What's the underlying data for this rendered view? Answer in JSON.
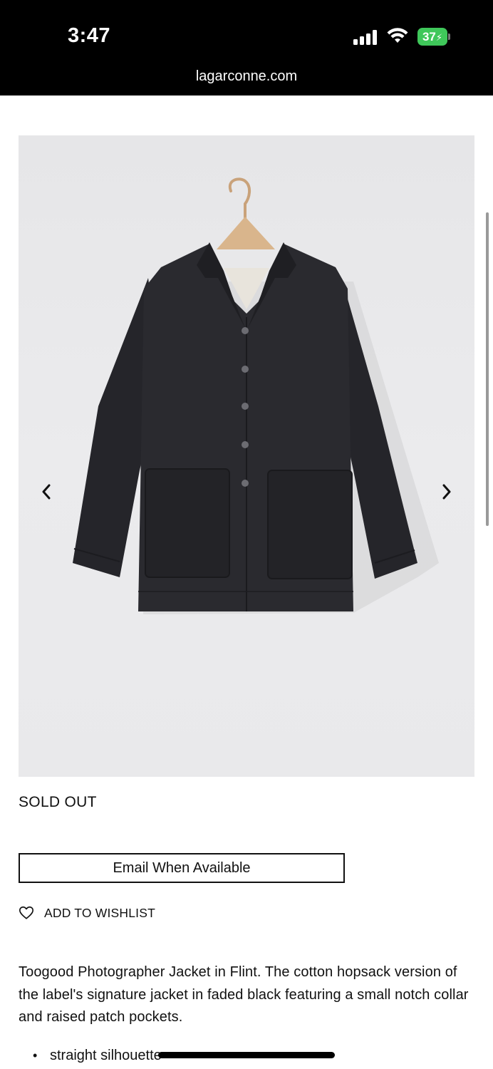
{
  "status_bar": {
    "time": "3:47",
    "battery": "37",
    "battery_color": "#3fc75a"
  },
  "browser": {
    "url": "lagarconne.com"
  },
  "gallery": {
    "prev_icon": "chevron-left-icon",
    "next_icon": "chevron-right-icon"
  },
  "product": {
    "availability": "SOLD OUT",
    "email_button_label": "Email When Available",
    "wishlist_label": "ADD TO WISHLIST",
    "description": "Toogood Photographer Jacket in Flint. The cotton hopsack version of the label's signature jacket in faded black featuring a small notch collar and raised patch pockets.",
    "features": [
      "straight silhouette"
    ]
  }
}
